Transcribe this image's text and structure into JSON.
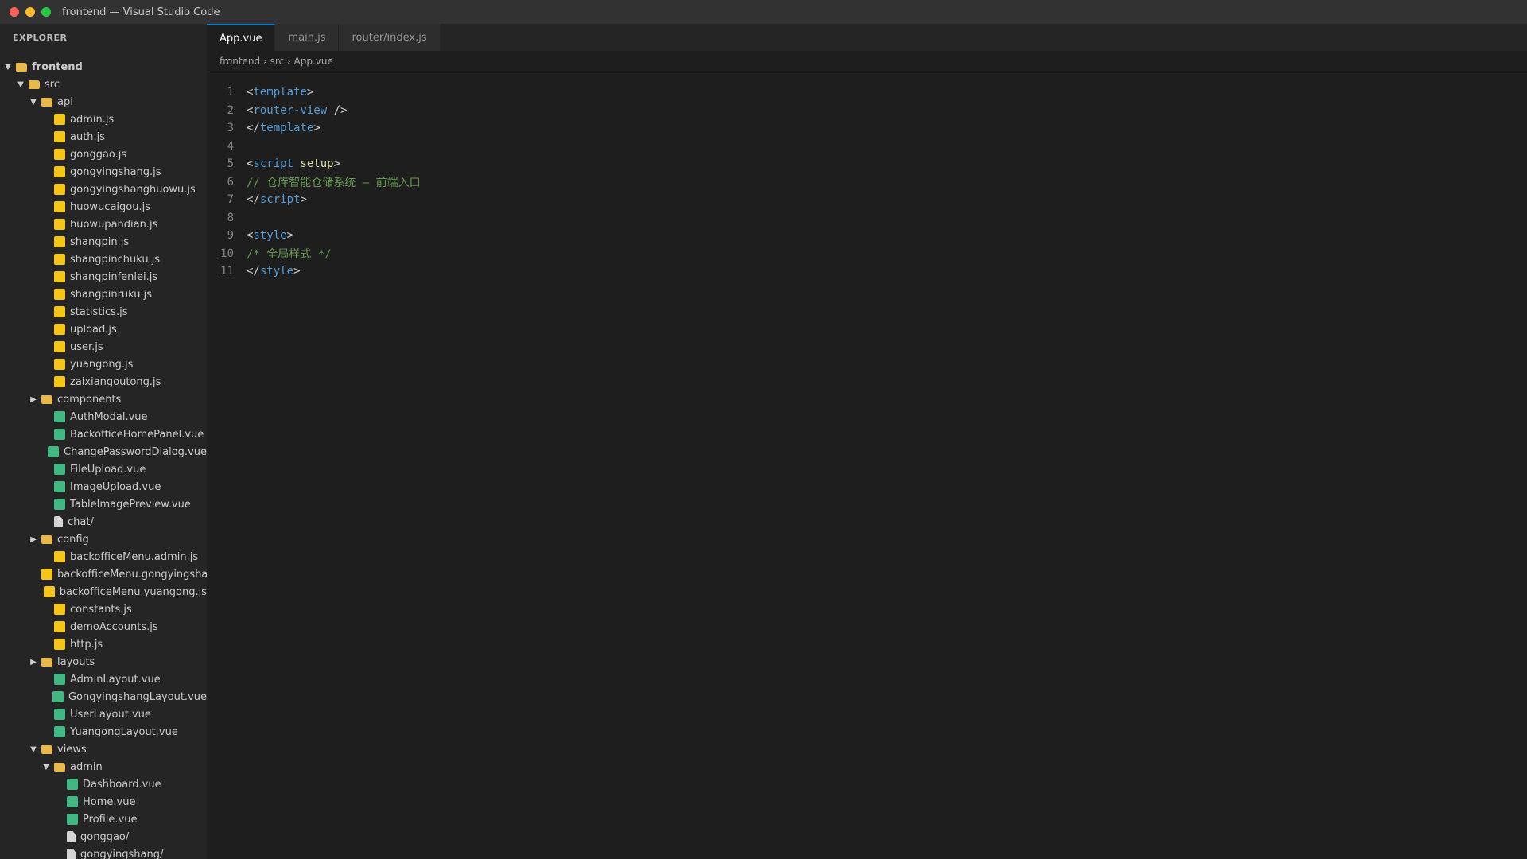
{
  "window": {
    "title": "frontend — Visual Studio Code",
    "traffic_lights": [
      "#ff5f57",
      "#febc2e",
      "#28c840"
    ]
  },
  "sidebar": {
    "header": "EXPLORER",
    "tree": [
      {
        "label": "frontend",
        "type": "folder",
        "depth": 0,
        "expanded": true,
        "bold": true
      },
      {
        "label": "src",
        "type": "folder",
        "depth": 1,
        "expanded": true
      },
      {
        "label": "api",
        "type": "folder",
        "depth": 2,
        "expanded": true
      },
      {
        "label": "admin.js",
        "type": "js",
        "depth": 3
      },
      {
        "label": "auth.js",
        "type": "js",
        "depth": 3
      },
      {
        "label": "gonggao.js",
        "type": "js",
        "depth": 3
      },
      {
        "label": "gongyingshang.js",
        "type": "js",
        "depth": 3
      },
      {
        "label": "gongyingshanghuowu.js",
        "type": "js",
        "depth": 3
      },
      {
        "label": "huowucaigou.js",
        "type": "js",
        "depth": 3
      },
      {
        "label": "huowupandian.js",
        "type": "js",
        "depth": 3
      },
      {
        "label": "shangpin.js",
        "type": "js",
        "depth": 3
      },
      {
        "label": "shangpinchuku.js",
        "type": "js",
        "depth": 3
      },
      {
        "label": "shangpinfenlei.js",
        "type": "js",
        "depth": 3
      },
      {
        "label": "shangpinruku.js",
        "type": "js",
        "depth": 3
      },
      {
        "label": "statistics.js",
        "type": "js",
        "depth": 3
      },
      {
        "label": "upload.js",
        "type": "js",
        "depth": 3
      },
      {
        "label": "user.js",
        "type": "js",
        "depth": 3
      },
      {
        "label": "yuangong.js",
        "type": "js",
        "depth": 3
      },
      {
        "label": "zaixiangoutong.js",
        "type": "js",
        "depth": 3
      },
      {
        "label": "components",
        "type": "folder",
        "depth": 2,
        "expanded": false
      },
      {
        "label": "AuthModal.vue",
        "type": "vue",
        "depth": 3
      },
      {
        "label": "BackofficeHomePanel.vue",
        "type": "vue",
        "depth": 3
      },
      {
        "label": "ChangePasswordDialog.vue",
        "type": "vue",
        "depth": 3
      },
      {
        "label": "FileUpload.vue",
        "type": "vue",
        "depth": 3
      },
      {
        "label": "ImageUpload.vue",
        "type": "vue",
        "depth": 3
      },
      {
        "label": "TableImagePreview.vue",
        "type": "vue",
        "depth": 3
      },
      {
        "label": "chat/",
        "type": "file",
        "depth": 3
      },
      {
        "label": "config",
        "type": "folder",
        "depth": 2,
        "expanded": false
      },
      {
        "label": "backofficeMenu.admin.js",
        "type": "js",
        "depth": 3
      },
      {
        "label": "backofficeMenu.gongyingshang.js",
        "type": "js",
        "depth": 3
      },
      {
        "label": "backofficeMenu.yuangong.js",
        "type": "js",
        "depth": 3
      },
      {
        "label": "constants.js",
        "type": "js",
        "depth": 3
      },
      {
        "label": "demoAccounts.js",
        "type": "js",
        "depth": 3
      },
      {
        "label": "http.js",
        "type": "js",
        "depth": 3
      },
      {
        "label": "layouts",
        "type": "folder",
        "depth": 2,
        "expanded": false
      },
      {
        "label": "AdminLayout.vue",
        "type": "vue",
        "depth": 3
      },
      {
        "label": "GongyingshangLayout.vue",
        "type": "vue",
        "depth": 3
      },
      {
        "label": "UserLayout.vue",
        "type": "vue",
        "depth": 3
      },
      {
        "label": "YuangongLayout.vue",
        "type": "vue",
        "depth": 3
      },
      {
        "label": "views",
        "type": "folder",
        "depth": 2,
        "expanded": true
      },
      {
        "label": "admin",
        "type": "folder",
        "depth": 3,
        "expanded": true
      },
      {
        "label": "Dashboard.vue",
        "type": "vue",
        "depth": 4
      },
      {
        "label": "Home.vue",
        "type": "vue",
        "depth": 4
      },
      {
        "label": "Profile.vue",
        "type": "vue",
        "depth": 4
      },
      {
        "label": "gonggao/",
        "type": "file",
        "depth": 4
      },
      {
        "label": "gongyingshang/",
        "type": "file",
        "depth": 4
      }
    ]
  },
  "tabs": [
    {
      "label": "App.vue",
      "active": true
    },
    {
      "label": "main.js",
      "active": false
    },
    {
      "label": "router/index.js",
      "active": false
    }
  ],
  "breadcrumb": "frontend › src › App.vue",
  "code": [
    {
      "n": "1",
      "tokens": [
        {
          "t": "<",
          "c": "punct"
        },
        {
          "t": "template",
          "c": "tag"
        },
        {
          "t": ">",
          "c": "punct"
        }
      ]
    },
    {
      "n": "2",
      "tokens": [
        {
          "t": "<",
          "c": "punct"
        },
        {
          "t": "router-view",
          "c": "tag"
        },
        {
          "t": " />",
          "c": "punct"
        }
      ]
    },
    {
      "n": "3",
      "tokens": [
        {
          "t": "</",
          "c": "punct"
        },
        {
          "t": "template",
          "c": "tag"
        },
        {
          "t": ">",
          "c": "punct"
        }
      ]
    },
    {
      "n": "4",
      "tokens": []
    },
    {
      "n": "5",
      "tokens": [
        {
          "t": "<",
          "c": "punct"
        },
        {
          "t": "script",
          "c": "tag"
        },
        {
          "t": " ",
          "c": "punct"
        },
        {
          "t": "setup",
          "c": "attr"
        },
        {
          "t": ">",
          "c": "punct"
        }
      ]
    },
    {
      "n": "6",
      "tokens": [
        {
          "t": "// 仓库智能仓储系统 — 前端入口",
          "c": "comment"
        }
      ]
    },
    {
      "n": "7",
      "tokens": [
        {
          "t": "</",
          "c": "punct"
        },
        {
          "t": "script",
          "c": "tag"
        },
        {
          "t": ">",
          "c": "punct"
        }
      ]
    },
    {
      "n": "8",
      "tokens": []
    },
    {
      "n": "9",
      "tokens": [
        {
          "t": "<",
          "c": "punct"
        },
        {
          "t": "style",
          "c": "tag"
        },
        {
          "t": ">",
          "c": "punct"
        }
      ]
    },
    {
      "n": "10",
      "tokens": [
        {
          "t": "/* 全局样式 */",
          "c": "comment"
        }
      ]
    },
    {
      "n": "11",
      "tokens": [
        {
          "t": "</",
          "c": "punct"
        },
        {
          "t": "style",
          "c": "tag"
        },
        {
          "t": ">",
          "c": "punct"
        }
      ]
    }
  ]
}
